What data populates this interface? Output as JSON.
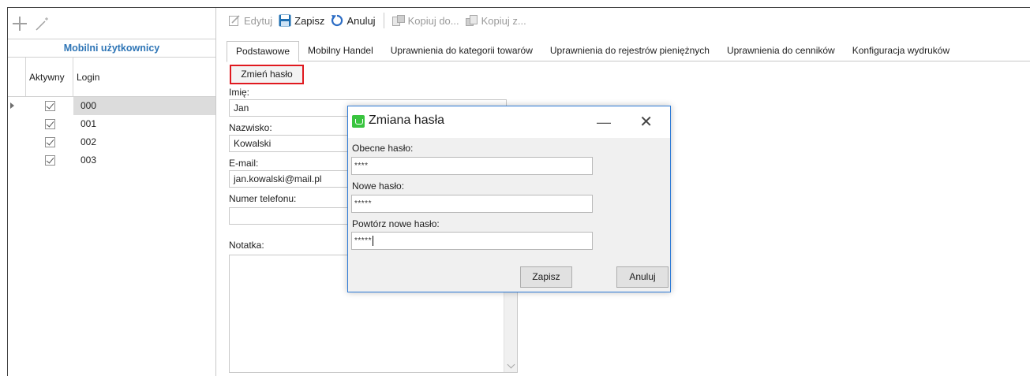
{
  "left_panel": {
    "title": "Mobilni użytkownicy",
    "columns": {
      "active": "Aktywny",
      "login": "Login"
    },
    "rows": [
      {
        "active": true,
        "login": "000",
        "selected": true
      },
      {
        "active": true,
        "login": "001",
        "selected": false
      },
      {
        "active": true,
        "login": "002",
        "selected": false
      },
      {
        "active": true,
        "login": "003",
        "selected": false
      }
    ],
    "icons": [
      "plus-icon",
      "wand-icon"
    ]
  },
  "toolbar": {
    "edit": "Edytuj",
    "save": "Zapisz",
    "cancel": "Anuluj",
    "copy_to": "Kopiuj do...",
    "copy_from": "Kopiuj z..."
  },
  "tabs": [
    "Podstawowe",
    "Mobilny Handel",
    "Uprawnienia do kategorii towarów",
    "Uprawnienia do rejestrów pieniężnych",
    "Uprawnienia do cenników",
    "Konfiguracja wydruków"
  ],
  "form": {
    "change_password": "Zmień hasło",
    "first_name_label": "Imię:",
    "first_name": "Jan",
    "last_name_label": "Nazwisko:",
    "last_name": "Kowalski",
    "email_label": "E-mail:",
    "email": "jan.kowalski@mail.pl",
    "phone_label": "Numer telefonu:",
    "phone": "",
    "note_label": "Notatka:"
  },
  "dialog": {
    "title": "Zmiana hasła",
    "current_label": "Obecne hasło:",
    "current_value": "****",
    "new_label": "Nowe hasło:",
    "new_value": "*****",
    "repeat_label": "Powtórz nowe hasło:",
    "repeat_value": "*****",
    "save": "Zapisz",
    "cancel": "Anuluj",
    "minimize_glyph": "—",
    "close_glyph": "✕"
  },
  "colors": {
    "title_blue": "#2e75b6",
    "highlight_red": "#e0191f",
    "dialog_border": "#2d7ad6",
    "save_icon": "#1f6fb2",
    "cancel_icon": "#2b6cc4"
  }
}
